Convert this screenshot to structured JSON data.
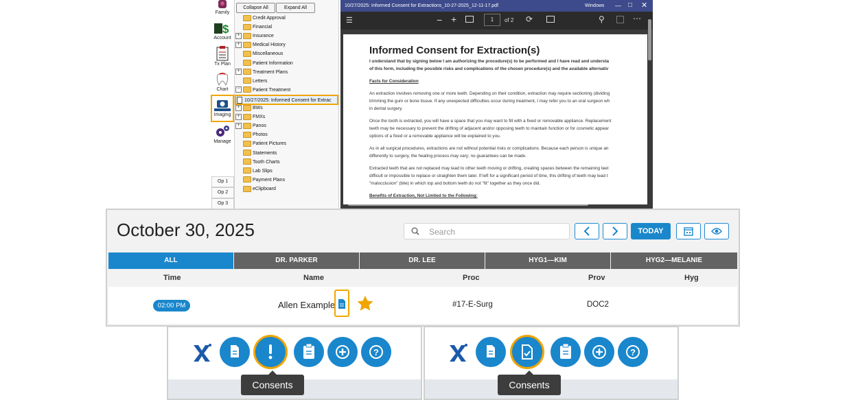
{
  "nav": {
    "items": [
      {
        "label": "Family"
      },
      {
        "label": "Account"
      },
      {
        "label": "Tx Plan"
      },
      {
        "label": "Chart"
      },
      {
        "label": "Imaging"
      },
      {
        "label": "Manage"
      }
    ],
    "ops": [
      "Op 1",
      "Op 2",
      "Op 3"
    ]
  },
  "tree": {
    "collapse_label": "Collapse All",
    "expand_label": "Expand All",
    "items": [
      {
        "label": "Credit Approval"
      },
      {
        "label": "Financial"
      },
      {
        "label": "Insurance"
      },
      {
        "label": "Medical History"
      },
      {
        "label": "Miscellaneous"
      },
      {
        "label": "Patient Information"
      },
      {
        "label": "Treatment Plans"
      },
      {
        "label": "Letters"
      },
      {
        "label": "Patient Treatment"
      },
      {
        "label": "10/27/2025: Informed Consent for Extrac"
      },
      {
        "label": "BWs"
      },
      {
        "label": "FMXs"
      },
      {
        "label": "Panos"
      },
      {
        "label": "Photos"
      },
      {
        "label": "Patient Pictures"
      },
      {
        "label": "Statements"
      },
      {
        "label": "Tooth Charts"
      },
      {
        "label": "Lab Slips"
      },
      {
        "label": "Payment Plans"
      },
      {
        "label": "eClipboard"
      }
    ]
  },
  "pdf": {
    "window_title": "10/27/2025: Informed Consent for Extractions_10-27-2025_12-11-17.pdf",
    "window_label": "Windows",
    "page_current": "1",
    "page_total": "of 2",
    "doc_title": "Informed Consent for Extraction(s)",
    "intro_1": "I understand that by signing below I am authorizing the procedure(s) to be performed and I have read and understa",
    "intro_2": "of this form, including the possible risks and complications of the chosen procedure(s) and the available alternativ",
    "heading_1": "Facts for Consideration",
    "p1_1": "An extraction involves removing one or more teeth. Depending on their condition, extraction may require sectioning (dividing",
    "p1_2": "trimming the gum or bone tissue. If any unexpected difficulties occur during treatment, I may refer you to an oral surgeon wh",
    "p1_3": "in dental surgery.",
    "p2_1": "Once the tooth is extracted, you will have a space that you may want to fill with a fixed or removable appliance. Replacement",
    "p2_2": "teeth may be necessary to prevent the drifting of adjacent and/or opposing teeth to maintain function or for cosmetic appear",
    "p2_3": "options of a fixed or a removable appliance will be explained to you.",
    "p3_1": "As in all surgical procedures, extractions are not without potential risks or complications. Because each person is unique an",
    "p3_2": "differently to surgery, the healing process may vary; no guarantees can be made.",
    "p4_1": "Extracted teeth that are not replaced may lead to other teeth moving or drifting, creating spaces between the remaining teet",
    "p4_2": "difficult or impossible to replace or straighten them later. If left for a significant period of time, this drifting of teeth may lead t",
    "p4_3": "\"malocclusion\" (bite) in which top and bottom teeth do not \"fit\" together as they once did.",
    "heading_2": "Benefits of Extraction, Not Limited to the Following:"
  },
  "schedule": {
    "date": "October 30, 2025",
    "search_placeholder": "Search",
    "today_label": "TODAY",
    "tabs": [
      "ALL",
      "DR. PARKER",
      "DR. LEE",
      "HYG1—KIM",
      "HYG2—MELANIE"
    ],
    "columns": [
      "Time",
      "Name",
      "Proc",
      "Prov",
      "Hyg"
    ],
    "row": {
      "time": "02:00 PM",
      "name": "Allen Example",
      "proc": "#17-E-Surg",
      "prov": "DOC2",
      "hyg": ""
    }
  },
  "bottom": {
    "left_tooltip": "Consents",
    "right_tooltip": "Consents"
  },
  "colors": {
    "accent": "#1a87cc",
    "highlight": "#f0a500",
    "tab": "#636363",
    "pdf_title_bar": "#3d4a8b"
  }
}
